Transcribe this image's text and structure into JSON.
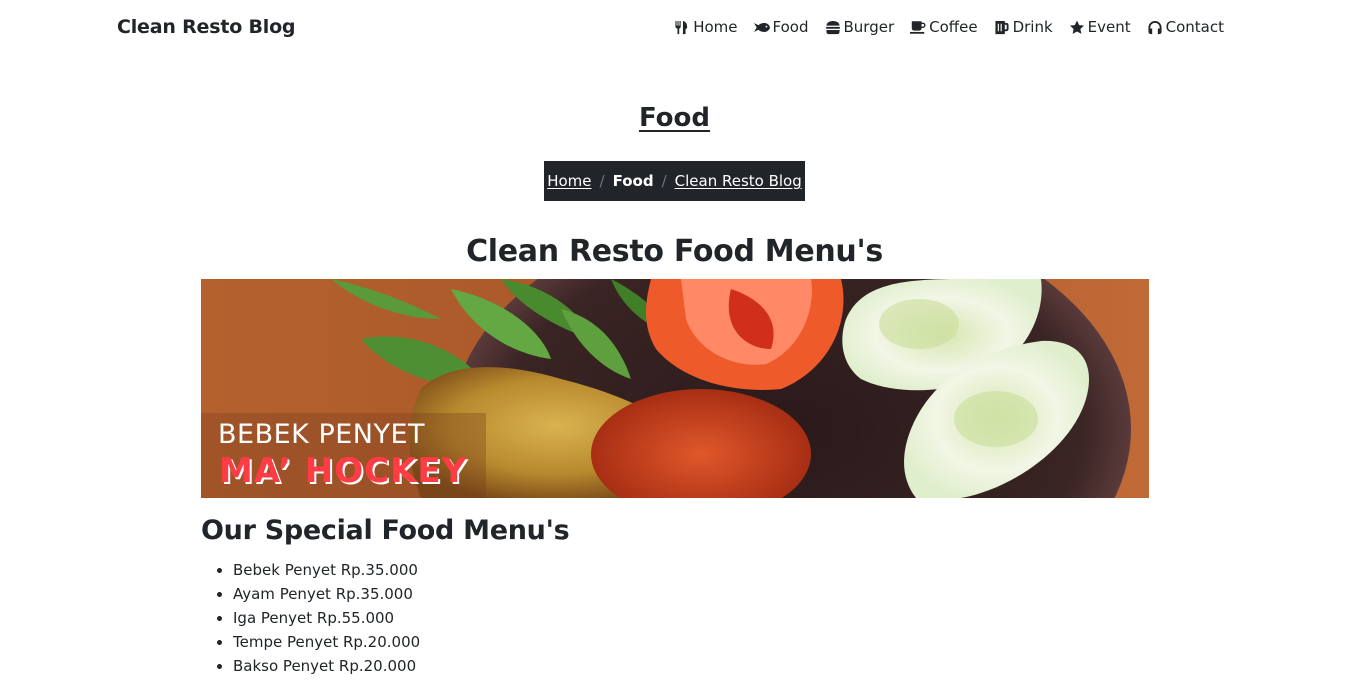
{
  "navbar": {
    "brand": "Clean Resto Blog",
    "items": [
      {
        "label": "Home",
        "icon": "utensils-icon"
      },
      {
        "label": "Food",
        "icon": "fish-icon"
      },
      {
        "label": "Burger",
        "icon": "hamburger-icon"
      },
      {
        "label": "Coffee",
        "icon": "coffee-icon"
      },
      {
        "label": "Drink",
        "icon": "beer-mug-icon"
      },
      {
        "label": "Event",
        "icon": "star-icon"
      },
      {
        "label": "Contact",
        "icon": "headphones-icon"
      }
    ]
  },
  "page": {
    "title": "Food"
  },
  "breadcrumb": {
    "items": [
      {
        "label": "Home",
        "link": true
      },
      {
        "label": "Food",
        "active": true
      },
      {
        "label": "Clean Resto Blog",
        "link": true
      }
    ],
    "separator": "/"
  },
  "main": {
    "heading": "Clean Resto Food Menu's",
    "banner": {
      "line1": "BEBEK PENYET",
      "line2": "MA’ HOCKEY",
      "alt": "Bebek penyet dish with basil, tomato, sambal and cucumber"
    },
    "special": {
      "heading": "Our Special Food Menu's",
      "items": [
        "Bebek Penyet Rp.35.000",
        "Ayam Penyet Rp.35.000",
        "Iga Penyet Rp.55.000",
        "Tempe Penyet Rp.20.000",
        "Bakso Penyet Rp.20.000"
      ]
    }
  },
  "colors": {
    "text": "#212529",
    "breadcrumb_bg": "#212529",
    "breadcrumb_sep": "#6c757d",
    "banner_red": "#ff3b44"
  }
}
